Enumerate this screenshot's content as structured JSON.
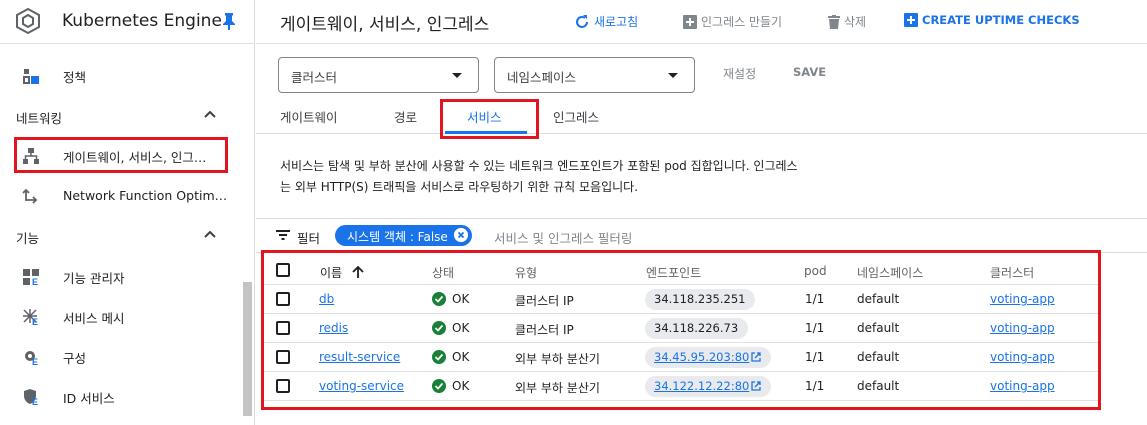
{
  "sidebar": {
    "product_title": "Kubernetes Engine",
    "items": {
      "policy": "정책",
      "gateway": "게이트웨이, 서비스, 인그레스",
      "nfo": "Network Function Optimizer",
      "feature_manager": "기능 관리자",
      "service_mesh": "서비스 메시",
      "config": "구성",
      "identity": "ID 서비스"
    },
    "sections": {
      "networking": "네트워킹",
      "features": "기능"
    }
  },
  "header": {
    "title": "게이트웨이, 서비스, 인그레스",
    "refresh": "새로고침",
    "create_ingress": "인그레스 만들기",
    "delete": "삭제",
    "uptime": "CREATE UPTIME CHECKS"
  },
  "filters": {
    "cluster": "클러스터",
    "namespace": "네임스페이스",
    "reset": "재설정",
    "save": "SAVE"
  },
  "tabs": [
    "게이트웨이",
    "경로",
    "서비스",
    "인그레스"
  ],
  "description": "서비스는 탐색 및 부하 분산에 사용할 수 있는 네트워크 엔드포인트가 포함된 pod 집합입니다. 인그레스는 외부 HTTP(S) 트래픽을 서비스로 라우팅하기 위한 규칙 모음입니다.",
  "filterbar": {
    "label": "필터",
    "chip": "시스템 객체 : False",
    "hint": "서비스 및 인그레스 필터링"
  },
  "table": {
    "headers": {
      "name": "이름",
      "status": "상태",
      "type": "유형",
      "endpoint": "엔드포인트",
      "pod": "pod",
      "namespace": "네임스페이스",
      "cluster": "클러스터"
    },
    "rows": [
      {
        "name": "db",
        "status": "OK",
        "type": "클러스터 IP",
        "endpoint": "34.118.235.251",
        "pod": "1/1",
        "namespace": "default",
        "cluster": "voting-app"
      },
      {
        "name": "redis",
        "status": "OK",
        "type": "클러스터 IP",
        "endpoint": "34.118.226.73",
        "pod": "1/1",
        "namespace": "default",
        "cluster": "voting-app"
      },
      {
        "name": "result-service",
        "status": "OK",
        "type": "외부 부하 분산기",
        "endpoint": "34.45.95.203:80",
        "pod": "1/1",
        "namespace": "default",
        "cluster": "voting-app"
      },
      {
        "name": "voting-service",
        "status": "OK",
        "type": "외부 부하 분산기",
        "endpoint": "34.122.12.22:80",
        "pod": "1/1",
        "namespace": "default",
        "cluster": "voting-app"
      }
    ]
  },
  "colors": {
    "accent": "#1a73e8",
    "highlight": "#e0151f",
    "ok": "#188038"
  }
}
